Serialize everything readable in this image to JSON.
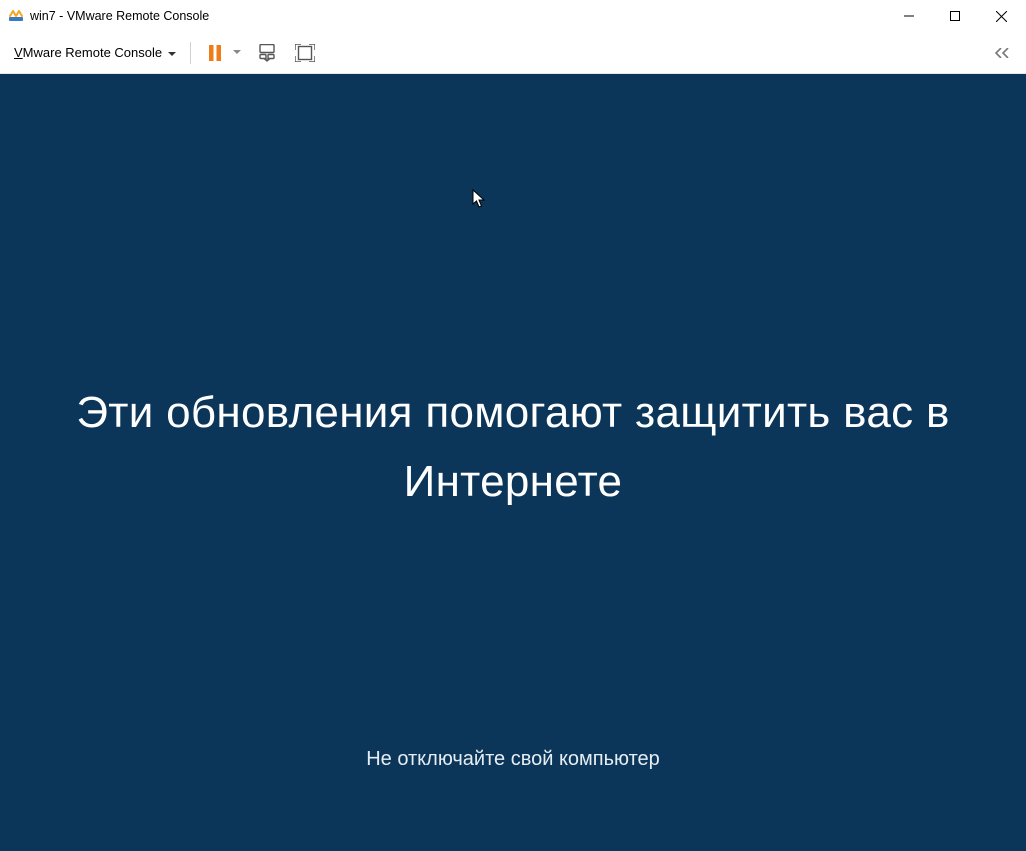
{
  "window": {
    "title": "win7 - VMware Remote Console"
  },
  "toolbar": {
    "menu_label_first": "V",
    "menu_label_rest": "Mware Remote Console"
  },
  "vm_screen": {
    "main_text": "Эти обновления помогают защитить вас в Интернете",
    "sub_text": "Не отключайте свой компьютер"
  },
  "colors": {
    "vm_bg": "#0b3659",
    "pause_orange": "#ef7c1a"
  }
}
